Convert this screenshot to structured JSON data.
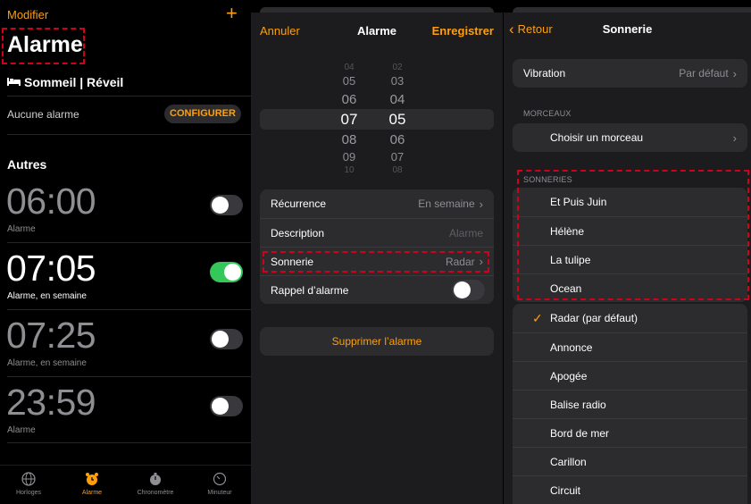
{
  "list": {
    "edit_label": "Modifier",
    "add_label": "+",
    "title": "Alarme",
    "sleep_title": "Sommeil | Réveil",
    "no_alarm": "Aucune alarme",
    "configure_label": "CONFIGURER",
    "others_title": "Autres",
    "alarms": [
      {
        "time": "06:00",
        "label": "Alarme",
        "enabled": false
      },
      {
        "time": "07:05",
        "label": "Alarme, en semaine",
        "enabled": true
      },
      {
        "time": "07:25",
        "label": "Alarme, en semaine",
        "enabled": false
      },
      {
        "time": "23:59",
        "label": "Alarme",
        "enabled": false
      }
    ],
    "tabs": [
      {
        "label": "Horloges",
        "icon": "globe-icon",
        "active": false
      },
      {
        "label": "Alarme",
        "icon": "alarm-clock-icon",
        "active": true
      },
      {
        "label": "Chronomètre",
        "icon": "stopwatch-icon",
        "active": false
      },
      {
        "label": "Minuteur",
        "icon": "timer-icon",
        "active": false
      }
    ]
  },
  "edit": {
    "cancel_label": "Annuler",
    "title": "Alarme",
    "save_label": "Enregistrer",
    "hours": [
      "04",
      "05",
      "06",
      "07",
      "08",
      "09",
      "10"
    ],
    "minutes": [
      "02",
      "03",
      "04",
      "05",
      "06",
      "07",
      "08"
    ],
    "selected_hour": "07",
    "selected_minute": "05",
    "repeat_label": "Récurrence",
    "repeat_value": "En semaine",
    "description_label": "Description",
    "description_placeholder": "Alarme",
    "sound_label": "Sonnerie",
    "sound_value": "Radar",
    "snooze_label": "Rappel d’alarme",
    "snooze_enabled": false,
    "delete_label": "Supprimer l’alarme"
  },
  "sound": {
    "back_label": "Retour",
    "title": "Sonnerie",
    "vibration_label": "Vibration",
    "vibration_value": "Par défaut",
    "songs_section": "MORCEAUX",
    "choose_song": "Choisir un morceau",
    "tones_section": "SONNERIES",
    "custom_tones": [
      "Et Puis Juin",
      "Hélène",
      "La tulipe",
      "Ocean"
    ],
    "tones": [
      "Radar (par défaut)",
      "Annonce",
      "Apogée",
      "Balise radio",
      "Bord de mer",
      "Carillon",
      "Circuit"
    ],
    "selected_tone": "Radar (par défaut)"
  },
  "colors": {
    "accent": "#ff9f0a",
    "toggle_on": "#34c759",
    "highlight": "#d0021b"
  }
}
